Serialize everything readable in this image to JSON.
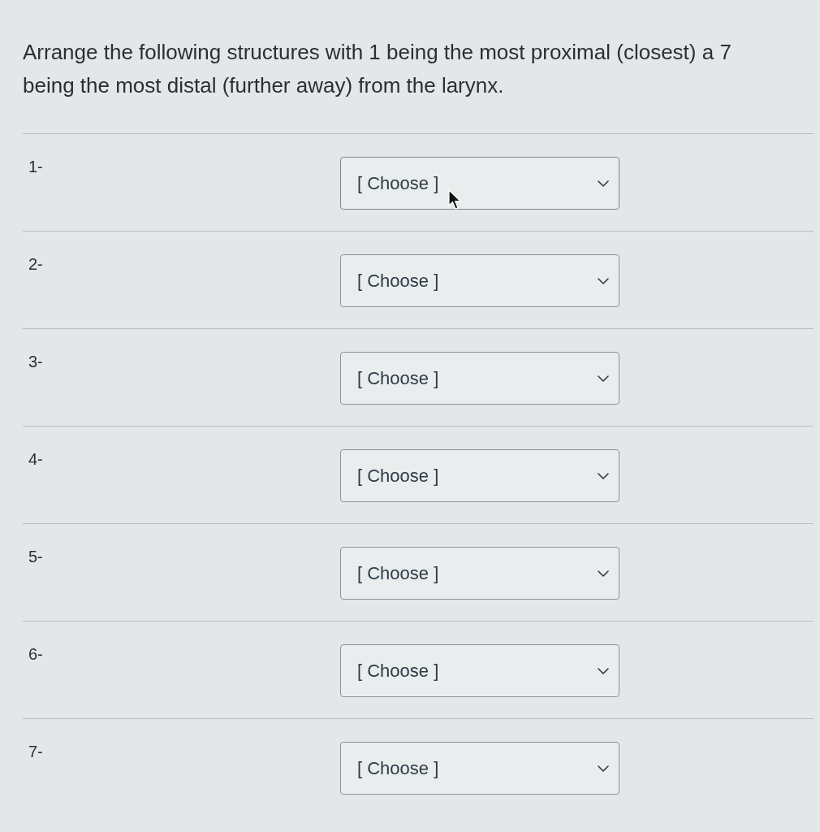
{
  "question": {
    "text": "Arrange the following structures with 1 being the most proximal (closest) a 7 being the most distal (further away) from the larynx."
  },
  "rows": [
    {
      "label": "1-",
      "select": {
        "value": "[ Choose ]"
      },
      "hovered": true
    },
    {
      "label": "2-",
      "select": {
        "value": "[ Choose ]"
      },
      "hovered": false
    },
    {
      "label": "3-",
      "select": {
        "value": "[ Choose ]"
      },
      "hovered": false
    },
    {
      "label": "4-",
      "select": {
        "value": "[ Choose ]"
      },
      "hovered": false
    },
    {
      "label": "5-",
      "select": {
        "value": "[ Choose ]"
      },
      "hovered": false
    },
    {
      "label": "6-",
      "select": {
        "value": "[ Choose ]"
      },
      "hovered": false
    },
    {
      "label": "7-",
      "select": {
        "value": "[ Choose ]"
      },
      "hovered": false
    }
  ]
}
